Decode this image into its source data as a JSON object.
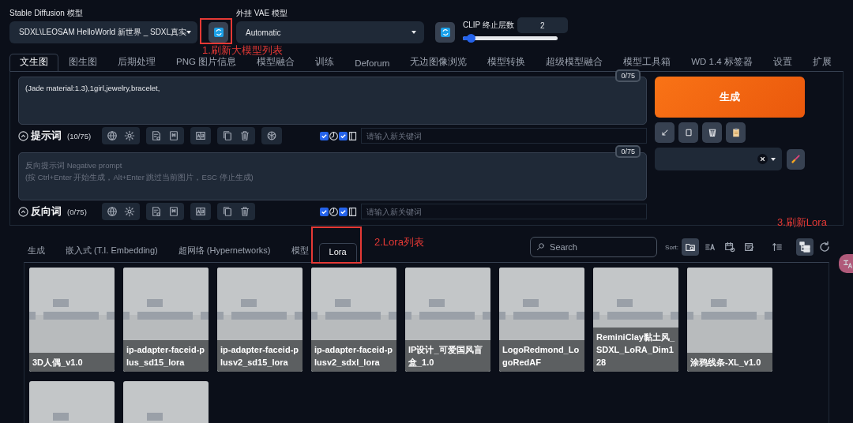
{
  "model_selectors": [
    {
      "label": "Stable Diffusion 模型",
      "value": "SDXL\\LEOSAM HelloWorld 新世界 _ SDXL真实"
    },
    {
      "label": "外挂 VAE 模型",
      "value": "Automatic"
    }
  ],
  "clip": {
    "label": "CLIP 终止层数",
    "value": "2",
    "level": 0.08
  },
  "main_tabs": [
    {
      "label": "文生图",
      "selected": true
    },
    {
      "label": "图生图",
      "selected": false
    },
    {
      "label": "后期处理",
      "selected": false
    },
    {
      "label": "PNG 图片信息",
      "selected": false
    },
    {
      "label": "模型融合",
      "selected": false
    },
    {
      "label": "训练",
      "selected": false
    },
    {
      "label": "Deforum",
      "selected": false
    },
    {
      "label": "无边图像浏览",
      "selected": false
    },
    {
      "label": "模型转换",
      "selected": false
    },
    {
      "label": "超级模型融合",
      "selected": false
    },
    {
      "label": "模型工具箱",
      "selected": false
    },
    {
      "label": "WD 1.4 标签器",
      "selected": false
    },
    {
      "label": "设置",
      "selected": false
    },
    {
      "label": "扩展",
      "selected": false
    }
  ],
  "prompts": [
    {
      "kind": "positive",
      "text": "(Jade material:1.3),1girl,jewelry,bracelet,",
      "counter": "0/75",
      "label": "提示词",
      "count": "(10/75)",
      "toggles": [
        {
          "checked": true
        },
        {
          "checked": true
        }
      ],
      "keyword_placeholder": "请输入新关键词"
    },
    {
      "kind": "negative",
      "placeholder": "反向提示词 Negative prompt\n(按 Ctrl+Enter 开始生成，Alt+Enter 跳过当前图片，ESC 停止生成)",
      "counter": "0/75",
      "label": "反向词",
      "count": "(0/75)",
      "toggles": [
        {
          "checked": true
        },
        {
          "checked": true
        }
      ],
      "keyword_placeholder": "请输入新关键词"
    }
  ],
  "generate_button": "生成",
  "network_tabs": [
    {
      "label": "生成",
      "selected": false
    },
    {
      "label": "嵌入式 (T.I. Embedding)",
      "selected": false
    },
    {
      "label": "超网络 (Hypernetworks)",
      "selected": false
    },
    {
      "label": "模型",
      "selected": false
    },
    {
      "label": "Lora",
      "selected": true
    }
  ],
  "search": {
    "placeholder": "Search"
  },
  "sort": {
    "label": "Sort:",
    "options": [
      {
        "selected": true
      },
      {
        "selected": false
      },
      {
        "selected": false
      },
      {
        "selected": false
      }
    ]
  },
  "tree_view": {
    "on": true
  },
  "lora_cards": [
    {
      "name": "3D人偶_v1.0"
    },
    {
      "name": "ip-adapter-faceid-plus_sd15_lora"
    },
    {
      "name": "ip-adapter-faceid-plusv2_sd15_lora"
    },
    {
      "name": "ip-adapter-faceid-plusv2_sdxl_lora"
    },
    {
      "name": "IP设计_可爱国风盲盒_1.0"
    },
    {
      "name": "LogoRedmond_LogoRedAF"
    },
    {
      "name": "ReminiClay黏土风_SDXL_LoRA_Dim128"
    },
    {
      "name": "涂鸦线条-XL_v1.0"
    },
    {
      "kind": "picture"
    },
    {
      "kind": "picture"
    }
  ],
  "annotations": [
    {
      "text": "1.刷新大模型列表",
      "framed": true
    },
    {
      "text": "2.Lora列表",
      "framed": true
    },
    {
      "text": "3.刷新Lora",
      "framed": false
    }
  ]
}
